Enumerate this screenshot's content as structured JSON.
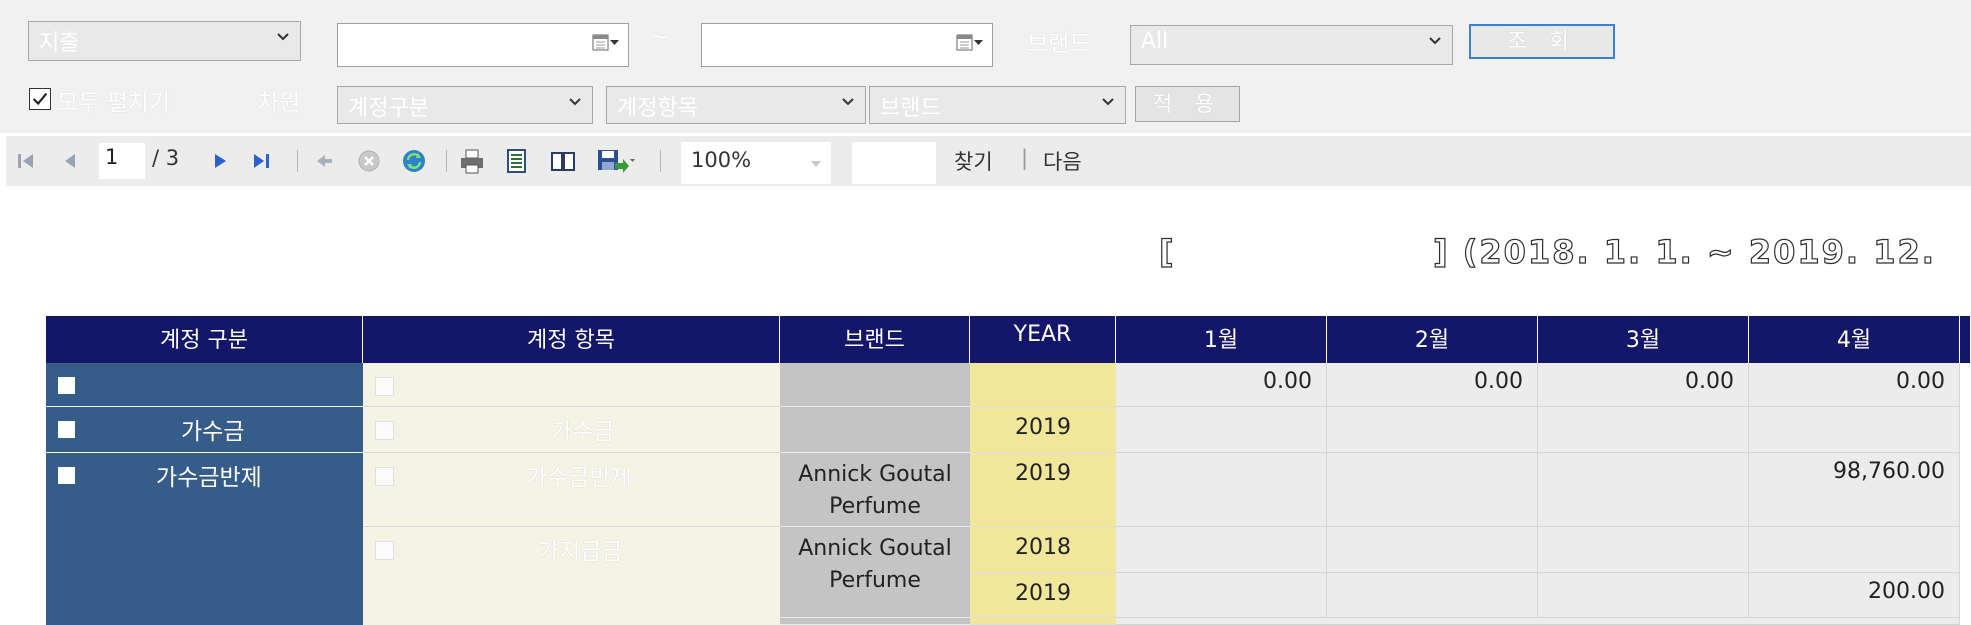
{
  "filters": {
    "type_select": "지출",
    "tilde": "~",
    "brand_label": "브랜드",
    "brand_select": "All",
    "query_button": "조 회",
    "expand_all_label": "모두 펼치기",
    "expand_all_checked": true,
    "dimension_label": "차원",
    "dim1": "계정구분",
    "dim2": "계정항목",
    "dim3": "브랜드",
    "apply_button": "적 용"
  },
  "toolbar": {
    "page_current": "1",
    "page_total": "/ 3",
    "zoom": "100%",
    "find_label": "찾기",
    "separator": "|",
    "next_label": "다음"
  },
  "report": {
    "title_open": "[",
    "title_close": "] (2018. 1. 1. ~ 2019. 12."
  },
  "table": {
    "headers": [
      "계정 구분",
      "계정 항목",
      "브랜드",
      "YEAR",
      "1월",
      "2월",
      "3월",
      "4월"
    ],
    "total_row": [
      "0.00",
      "0.00",
      "0.00",
      "0.00"
    ],
    "row1": {
      "category": "가수금",
      "item": "가수금",
      "brand": "",
      "year": "2019",
      "values": [
        "",
        "",
        "",
        ""
      ]
    },
    "row2": {
      "category": "가수금반제",
      "item": "가수금반제",
      "brand": "Annick Goutal Perfume",
      "year": "2019",
      "values": [
        "",
        "",
        "",
        "98,760.00"
      ]
    },
    "row3": {
      "item": "가지급금",
      "brand": "Annick Goutal Perfume",
      "year_a": "2018",
      "year_b": "2019",
      "values_a": [
        "",
        "",
        "",
        ""
      ],
      "values_b": [
        "",
        "",
        "",
        "200.00"
      ]
    }
  },
  "colors": {
    "header_bg": "#14166a",
    "category_bg": "#365c8a",
    "year_bg": "#f0e79a",
    "brand_bg": "#c4c4c4",
    "focus": "#3d7fd0"
  }
}
